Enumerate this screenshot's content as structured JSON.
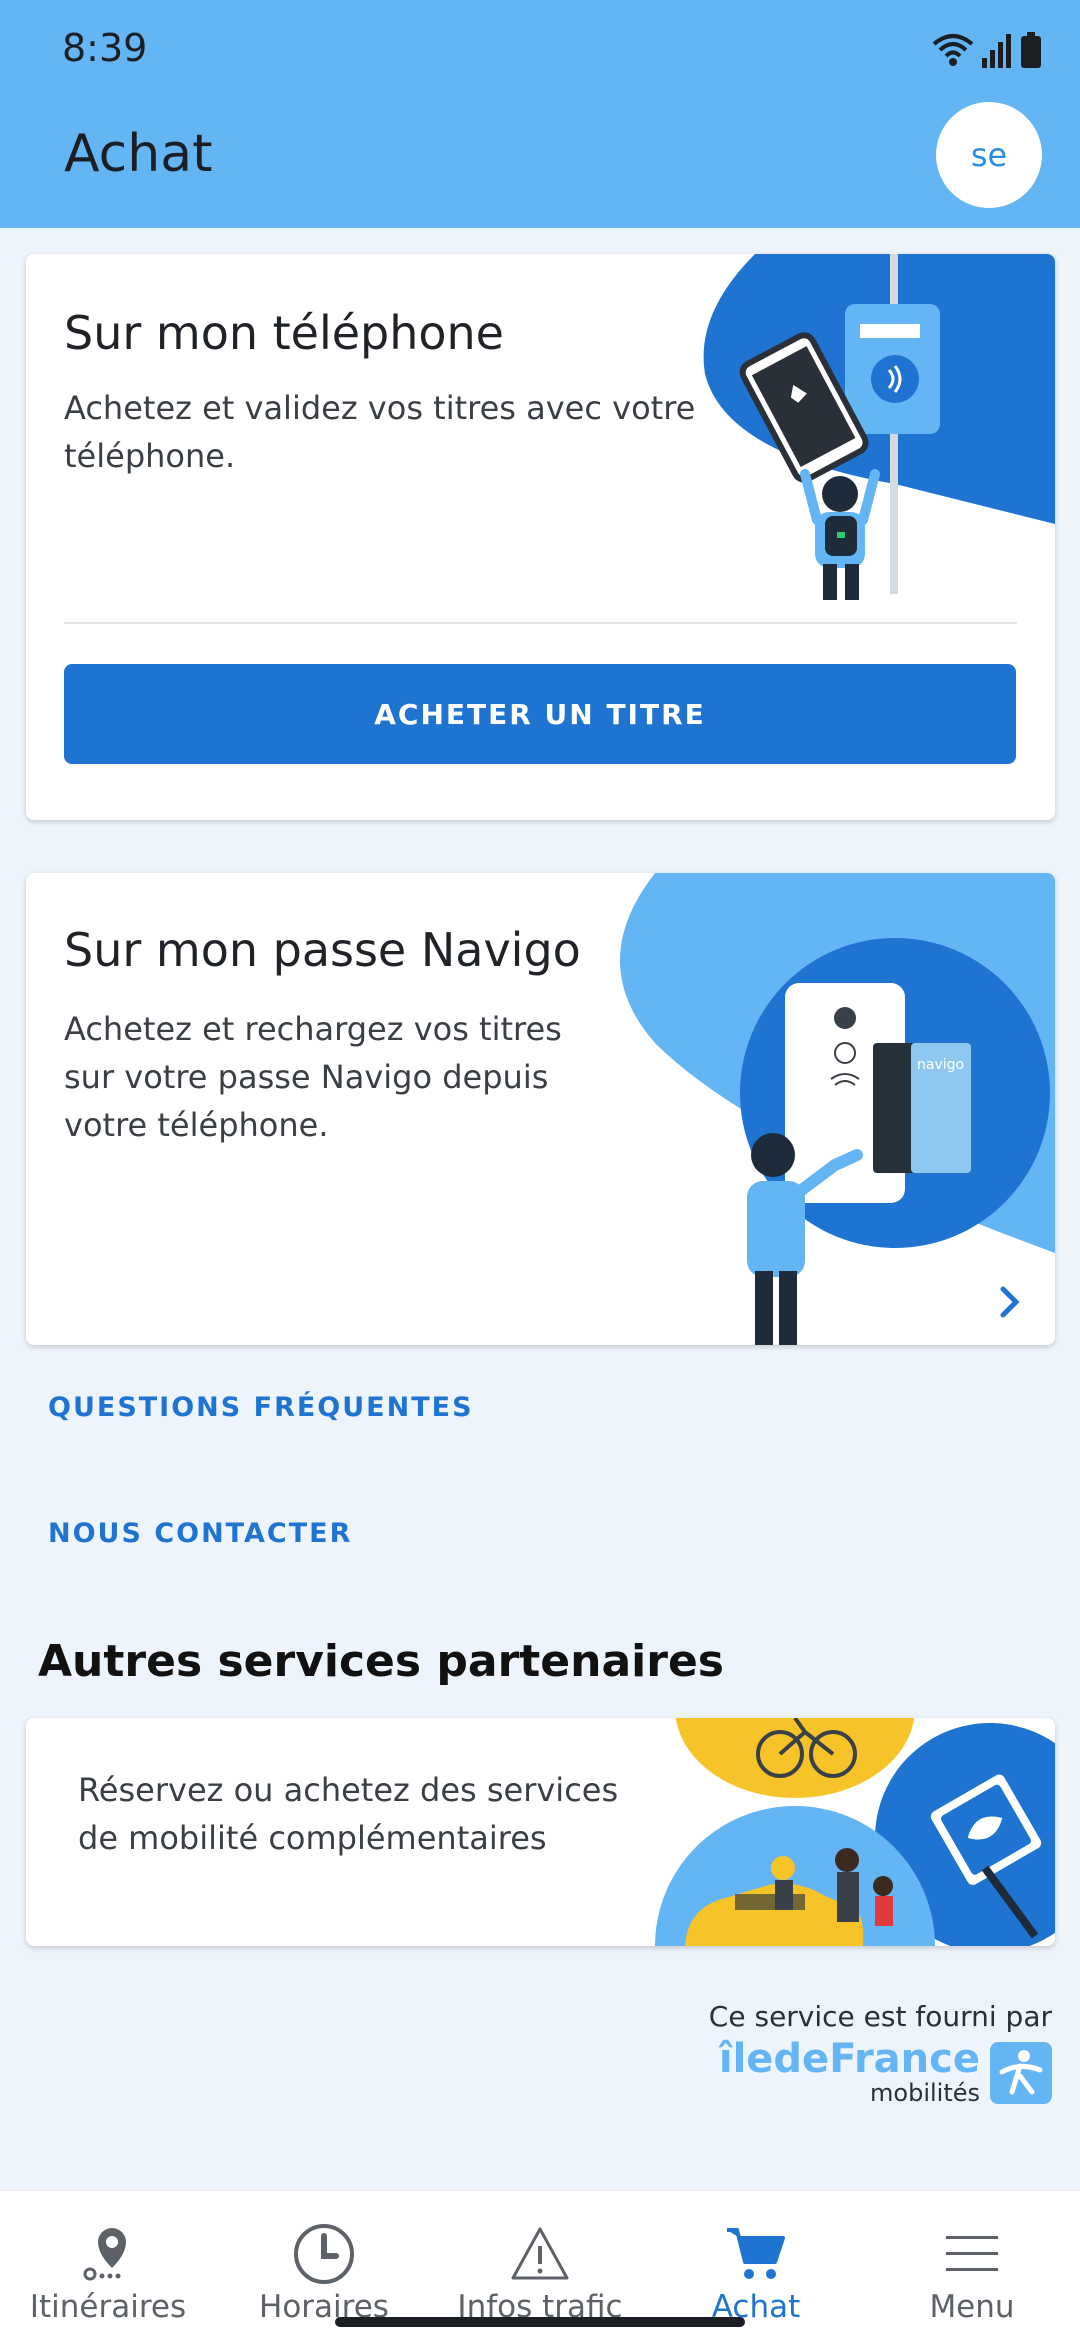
{
  "status_bar": {
    "time": "8:39"
  },
  "header": {
    "title": "Achat",
    "avatar_initials": "se"
  },
  "card_phone": {
    "title": "Sur mon téléphone",
    "description": "Achetez et validez vos titres avec votre téléphone.",
    "button_label": "ACHETER UN TITRE"
  },
  "card_navigo": {
    "title": "Sur mon passe Navigo",
    "description": "Achetez et rechargez vos titres sur votre passe Navigo depuis votre téléphone.",
    "card_brand": "navigo"
  },
  "links": {
    "faq": "QUESTIONS FRÉQUENTES",
    "contact": "NOUS CONTACTER"
  },
  "partners": {
    "section_title": "Autres services partenaires",
    "description": "Réservez ou achetez des services de mobilité complémentaires"
  },
  "provider": {
    "text": "Ce service est fourni par",
    "logo_text": "îledeFrance",
    "logo_subtext": "mobilités"
  },
  "bottom_nav": {
    "items": [
      {
        "label": "Itinéraires",
        "icon": "location-pin-icon",
        "active": false
      },
      {
        "label": "Horaires",
        "icon": "clock-icon",
        "active": false
      },
      {
        "label": "Infos trafic",
        "icon": "warning-triangle-icon",
        "active": false
      },
      {
        "label": "Achat",
        "icon": "cart-icon",
        "active": true
      },
      {
        "label": "Menu",
        "icon": "hamburger-menu-icon",
        "active": false
      }
    ]
  },
  "colors": {
    "header_bg": "#64b5f4",
    "primary": "#1f74d2",
    "page_bg": "#eef4fc",
    "accent_yellow": "#f6c428"
  }
}
